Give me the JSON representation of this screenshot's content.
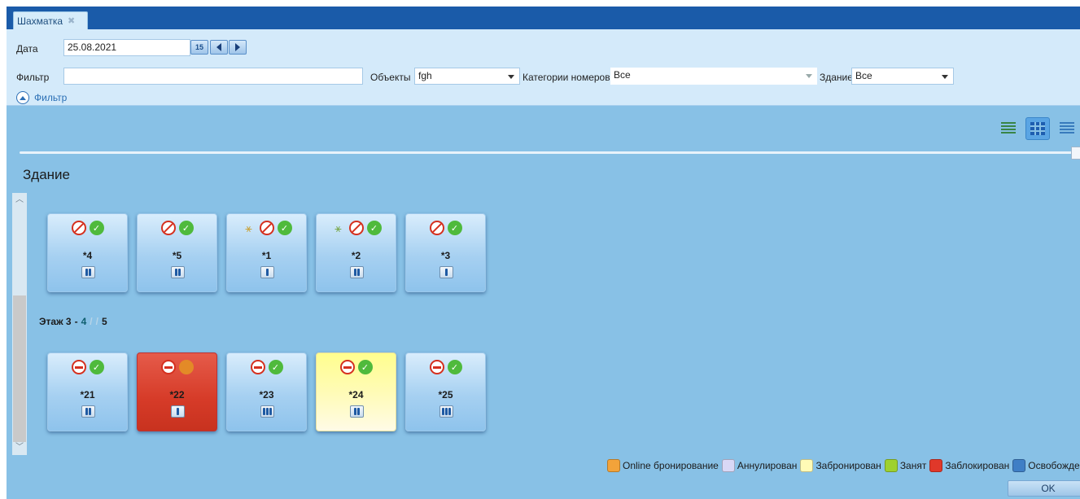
{
  "tab": {
    "title": "Шахматка",
    "close": "✖"
  },
  "filters": {
    "date_label": "Дата",
    "date_value": "25.08.2021",
    "calendar_day": "15",
    "filter_label": "Фильтр",
    "filter_value": "",
    "objects_label": "Объекты",
    "objects_value": "fgh",
    "room_categories_label": "Категории номеров",
    "room_categories_value": "Все",
    "building_label": "Здание",
    "building_value": "Все",
    "toggle_label": "Фильтр"
  },
  "building_title": "Здание",
  "rooms_top": [
    {
      "number": "*4",
      "occupancy": 2,
      "cleaning": false
    },
    {
      "number": "*5",
      "occupancy": 2,
      "cleaning": false
    },
    {
      "number": "*1",
      "occupancy": 1,
      "cleaning": true
    },
    {
      "number": "*2",
      "occupancy": 2,
      "cleaning": true
    },
    {
      "number": "*3",
      "occupancy": 1,
      "cleaning": false
    }
  ],
  "floor": {
    "label": "Этаж 3",
    "dash": "-",
    "free": "4",
    "sep": "/",
    "middle": "/",
    "total": "5"
  },
  "rooms_floor3": [
    {
      "number": "*21",
      "occupancy": 2,
      "status": "free"
    },
    {
      "number": "*22",
      "occupancy": 1,
      "status": "blocked"
    },
    {
      "number": "*23",
      "occupancy": 3,
      "status": "free"
    },
    {
      "number": "*24",
      "occupancy": 2,
      "status": "booked"
    },
    {
      "number": "*25",
      "occupancy": 3,
      "status": "free"
    }
  ],
  "legend": [
    {
      "label": "Online бронирование",
      "color": "#f2a33a"
    },
    {
      "label": "Аннулирован",
      "color": "#d9d8f6"
    },
    {
      "label": "Забронирован",
      "color": "#fffbb6"
    },
    {
      "label": "Занят",
      "color": "#9ed12f"
    },
    {
      "label": "Заблокирован",
      "color": "#e0382a"
    },
    {
      "label": "Освобожден",
      "color": "#3f7fc6"
    }
  ],
  "ok_label": "OK",
  "colors": {
    "titlebar": "#1a5ba9",
    "background": "#88c1e6",
    "panel": "#d4eafa"
  }
}
